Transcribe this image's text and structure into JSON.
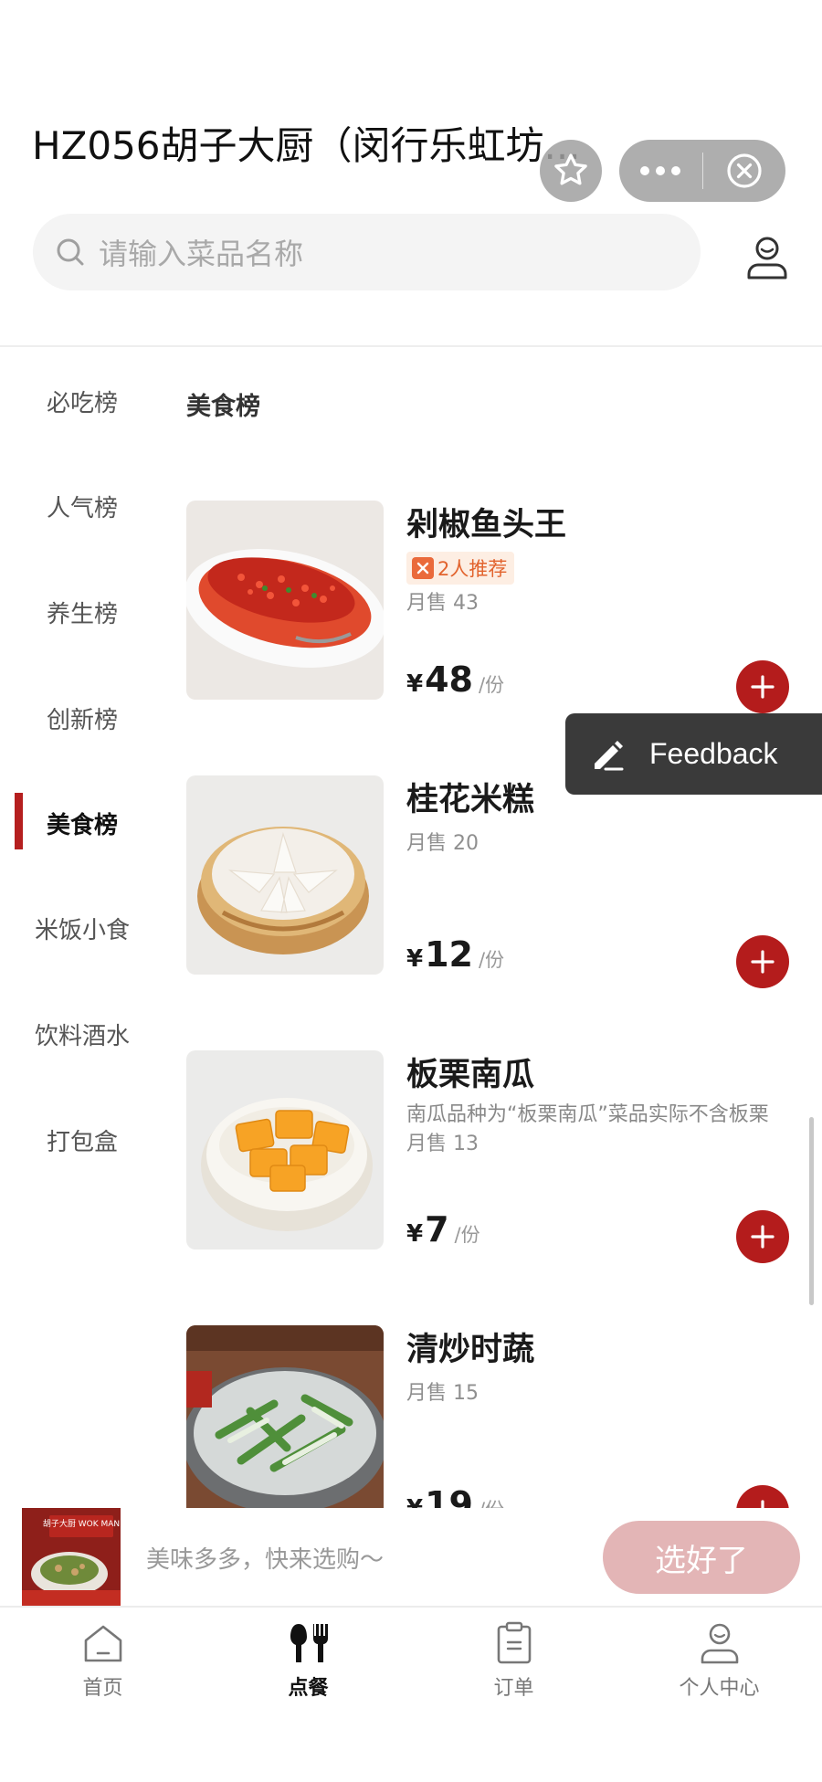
{
  "header": {
    "store_title": "HZ056胡子大厨（闵行乐虹坊...",
    "favorite_icon": "star-icon",
    "more_icon": "ellipsis-icon",
    "close_icon": "close-circle-icon"
  },
  "search": {
    "placeholder": "请输入菜品名称"
  },
  "sidebar": {
    "items": [
      {
        "label": "必吃榜"
      },
      {
        "label": "人气榜"
      },
      {
        "label": "养生榜"
      },
      {
        "label": "创新榜"
      },
      {
        "label": "美食榜"
      },
      {
        "label": "米饭小食"
      },
      {
        "label": "饮料酒水"
      },
      {
        "label": "打包盒"
      }
    ],
    "active_label": "美食榜"
  },
  "section": {
    "title": "美食榜"
  },
  "dishes": [
    {
      "name": "剁椒鱼头王",
      "badge": "2人推荐",
      "sales": "月售 43",
      "currency": "¥",
      "price": "48",
      "unit": "/份"
    },
    {
      "name": "桂花米糕",
      "sales": "月售 20",
      "currency": "¥",
      "price": "12",
      "unit": "/份"
    },
    {
      "name": "板栗南瓜",
      "desc": "南瓜品种为“板栗南瓜”菜品实际不含板栗",
      "sales": "月售 13",
      "currency": "¥",
      "price": "7",
      "unit": "/份"
    },
    {
      "name": "清炒时蔬",
      "sales": "月售 15",
      "currency": "¥",
      "price": "19",
      "unit": "/份"
    }
  ],
  "feedback": {
    "label": "Feedback"
  },
  "cart": {
    "hint": "美味多多，快来选购～",
    "button": "选好了",
    "thumb_text": "胡子大厨 WOK MAN"
  },
  "tabbar": {
    "items": [
      {
        "label": "首页"
      },
      {
        "label": "点餐"
      },
      {
        "label": "订单"
      },
      {
        "label": "个人中心"
      }
    ],
    "active": "点餐"
  },
  "colors": {
    "accent": "#b41c1c",
    "button_disabled": "#e3b5b6",
    "badge": "#e2632d"
  }
}
